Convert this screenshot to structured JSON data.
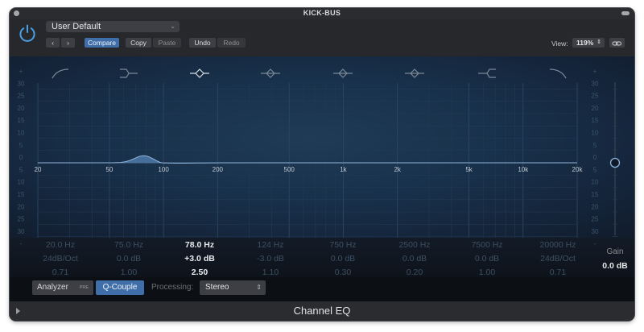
{
  "window": {
    "title": "KICK-BUS"
  },
  "header": {
    "preset": "User Default",
    "buttons": {
      "back": "‹",
      "forward": "›",
      "compare": "Compare",
      "copy": "Copy",
      "paste": "Paste",
      "undo": "Undo",
      "redo": "Redo"
    },
    "view_label": "View:",
    "view_value": "119%"
  },
  "db_scale": {
    "left": [
      "+",
      "30",
      "25",
      "20",
      "15",
      "10",
      "5",
      "0",
      "5",
      "10",
      "15",
      "20",
      "25",
      "30",
      "-"
    ],
    "right": [
      "+",
      "30",
      "25",
      "20",
      "15",
      "10",
      "5",
      "0",
      "5",
      "10",
      "15",
      "20",
      "25",
      "30",
      "-"
    ]
  },
  "freq_scale": [
    "20",
    "50",
    "100",
    "200",
    "500",
    "1k",
    "2k",
    "5k",
    "10k",
    "20k"
  ],
  "bands": [
    {
      "freq": "20.0 Hz",
      "gain": "24dB/Oct",
      "q": "0.71",
      "active": false,
      "icon": "low-cut-icon"
    },
    {
      "freq": "75.0 Hz",
      "gain": "0.0 dB",
      "q": "1.00",
      "active": false,
      "icon": "low-shelf-icon"
    },
    {
      "freq": "78.0 Hz",
      "gain": "+3.0 dB",
      "q": "2.50",
      "active": true,
      "icon": "bell-icon"
    },
    {
      "freq": "124 Hz",
      "gain": "-3.0 dB",
      "q": "1.10",
      "active": false,
      "icon": "bell-icon"
    },
    {
      "freq": "750 Hz",
      "gain": "0.0 dB",
      "q": "0.30",
      "active": false,
      "icon": "bell-icon"
    },
    {
      "freq": "2500 Hz",
      "gain": "0.0 dB",
      "q": "0.20",
      "active": false,
      "icon": "bell-icon"
    },
    {
      "freq": "7500 Hz",
      "gain": "0.0 dB",
      "q": "1.00",
      "active": false,
      "icon": "high-shelf-icon"
    },
    {
      "freq": "20000 Hz",
      "gain": "24dB/Oct",
      "q": "0.71",
      "active": false,
      "icon": "high-cut-icon"
    }
  ],
  "gain_control": {
    "label": "Gain",
    "value": "0.0 dB",
    "level_db": 0
  },
  "bottom": {
    "analyzer": "Analyzer",
    "analyzer_badge": "PRE",
    "q_couple": "Q-Couple",
    "processing_label": "Processing:",
    "processing_value": "Stereo"
  },
  "footer": {
    "plugin_name": "Channel EQ"
  },
  "colors": {
    "accent": "#3f6ea8",
    "curve_fill": "#4d79a8",
    "curve_line": "#8fb6dc",
    "grid": "#26415c"
  }
}
